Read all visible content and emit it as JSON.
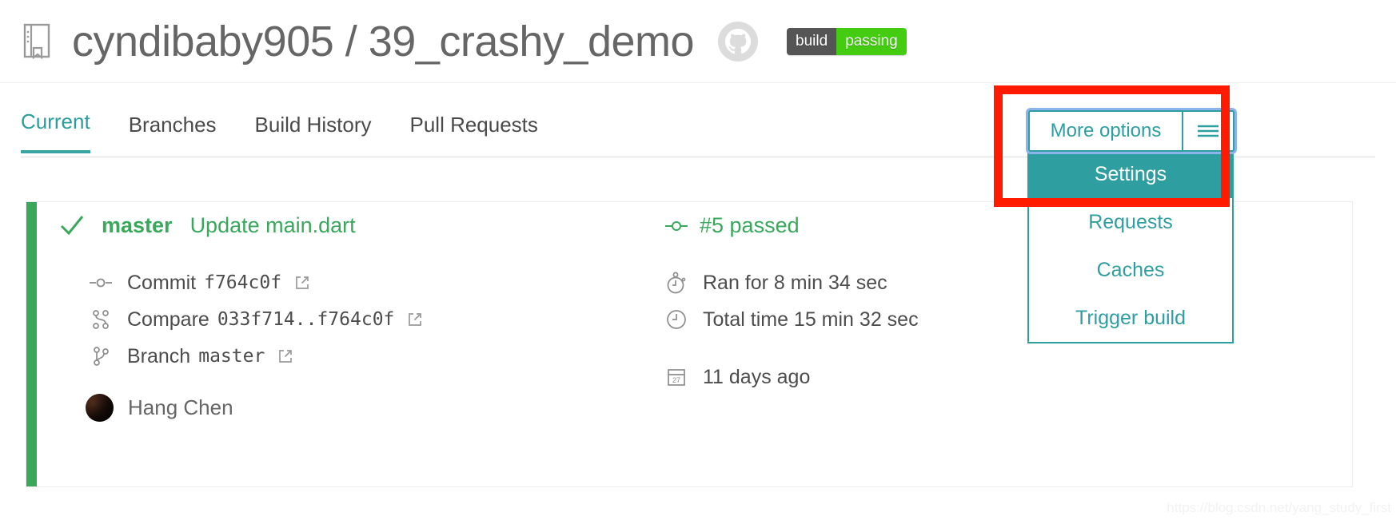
{
  "header": {
    "repo_icon": "book-icon",
    "title": "cyndibaby905 / 39_crashy_demo",
    "github_icon": "github-icon",
    "badge": {
      "left_label": "build",
      "right_label": "passing",
      "left_color": "#555555",
      "right_color": "#44cc11"
    }
  },
  "tabs": [
    {
      "label": "Current",
      "active": true
    },
    {
      "label": "Branches",
      "active": false
    },
    {
      "label": "Build History",
      "active": false
    },
    {
      "label": "Pull Requests",
      "active": false
    }
  ],
  "dropdown": {
    "button_label": "More options",
    "hamburger_icon": "hamburger-icon",
    "accent_color": "#2f9ea0",
    "focus_ring_color": "#8bb3ee",
    "items": [
      {
        "label": "Settings",
        "selected": true
      },
      {
        "label": "Requests",
        "selected": false
      },
      {
        "label": "Caches",
        "selected": false
      },
      {
        "label": "Trigger build",
        "selected": false
      }
    ]
  },
  "annotation": {
    "shape": "rectangle",
    "color": "#ff1a00"
  },
  "build": {
    "status_color": "#39a85b",
    "status_icon": "check-icon",
    "branch": "master",
    "commit_message": "Update main.dart",
    "build_number_icon": "commit-node-icon",
    "build_number": "#5 passed",
    "left_details": [
      {
        "icon": "commit-node-icon",
        "label": "Commit",
        "value": "f764c0f",
        "external_link_icon": "external-link-icon"
      },
      {
        "icon": "compare-icon",
        "label": "Compare",
        "value": "033f714..f764c0f",
        "external_link_icon": "external-link-icon"
      },
      {
        "icon": "branch-icon",
        "label": "Branch",
        "value": "master",
        "external_link_icon": "external-link-icon"
      }
    ],
    "right_details": [
      {
        "icon": "stopwatch-icon",
        "label": "Ran for 8 min 34 sec"
      },
      {
        "icon": "clock-icon",
        "label": "Total time 15 min 32 sec"
      },
      {
        "icon": "calendar-icon",
        "label": "11 days ago"
      }
    ],
    "author": {
      "avatar_icon": "avatar",
      "name": "Hang Chen"
    }
  },
  "watermark": "https://blog.csdn.net/yang_study_first"
}
